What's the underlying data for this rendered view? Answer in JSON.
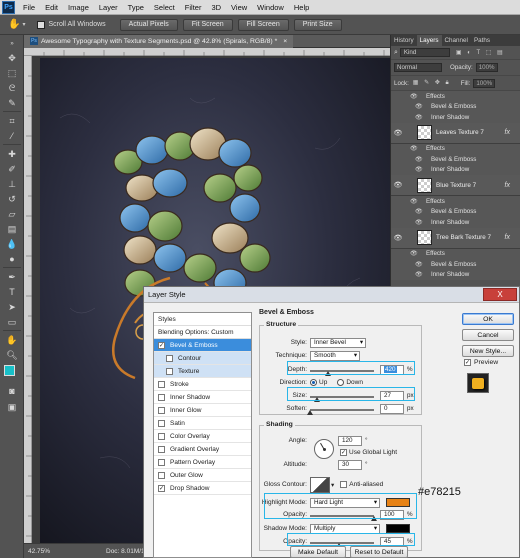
{
  "menubar": {
    "logo": "Ps",
    "items": [
      "File",
      "Edit",
      "Image",
      "Layer",
      "Type",
      "Select",
      "Filter",
      "3D",
      "View",
      "Window",
      "Help"
    ]
  },
  "options": {
    "scroll_all_windows": "Scroll All Windows",
    "buttons": [
      "Actual Pixels",
      "Fit Screen",
      "Fill Screen",
      "Print Size"
    ]
  },
  "document": {
    "tab_title": "Awesome Typography with Texture Segments.psd @ 42.8% (Spirals, RGB/8) *",
    "zoom": "42.75%",
    "doc_info": "Doc: 8.01M/125.8M"
  },
  "panels": {
    "tabs": [
      "History",
      "Layers",
      "Channel",
      "Paths"
    ],
    "active_tab": "Layers",
    "kind": "Kind",
    "blend_mode": "Normal",
    "opacity_label": "Opacity:",
    "opacity_value": "100%",
    "lock_label": "Lock:",
    "fill_label": "Fill:",
    "fill_value": "100%",
    "layers": [
      {
        "type": "sub",
        "label": "Effects",
        "effects": true
      },
      {
        "type": "sub",
        "label": "Bevel & Emboss"
      },
      {
        "type": "sub",
        "label": "Inner Shadow"
      },
      {
        "type": "layer",
        "label": "Leaves Texture 7",
        "fx": "fx"
      },
      {
        "type": "sub",
        "label": "Effects",
        "effects": true
      },
      {
        "type": "sub",
        "label": "Bevel & Emboss"
      },
      {
        "type": "sub",
        "label": "Inner Shadow"
      },
      {
        "type": "layer",
        "label": "Blue Texture 7",
        "fx": "fx"
      },
      {
        "type": "sub",
        "label": "Effects",
        "effects": true
      },
      {
        "type": "sub",
        "label": "Bevel & Emboss"
      },
      {
        "type": "sub",
        "label": "Inner Shadow"
      },
      {
        "type": "layer",
        "label": "Tree Bark Texture 7",
        "fx": "fx"
      },
      {
        "type": "sub",
        "label": "Effects",
        "effects": true
      },
      {
        "type": "sub",
        "label": "Bevel & Emboss"
      },
      {
        "type": "sub",
        "label": "Inner Shadow"
      }
    ]
  },
  "dialog": {
    "title": "Layer Style",
    "close": "X",
    "styles_header": "Styles",
    "blending_options": "Blending Options: Custom",
    "styles": [
      {
        "label": "Bevel & Emboss",
        "checked": true,
        "selected": true
      },
      {
        "label": "Contour",
        "checked": false,
        "indent": true
      },
      {
        "label": "Texture",
        "checked": false,
        "indent": true
      },
      {
        "label": "Stroke",
        "checked": false
      },
      {
        "label": "Inner Shadow",
        "checked": false
      },
      {
        "label": "Inner Glow",
        "checked": false
      },
      {
        "label": "Satin",
        "checked": false
      },
      {
        "label": "Color Overlay",
        "checked": false
      },
      {
        "label": "Gradient Overlay",
        "checked": false
      },
      {
        "label": "Pattern Overlay",
        "checked": false
      },
      {
        "label": "Outer Glow",
        "checked": false
      },
      {
        "label": "Drop Shadow",
        "checked": true
      }
    ],
    "section_title": "Bevel & Emboss",
    "structure": {
      "title": "Structure",
      "style_label": "Style:",
      "style_value": "Inner Bevel",
      "technique_label": "Technique:",
      "technique_value": "Smooth",
      "depth_label": "Depth:",
      "depth_value": "420",
      "depth_unit": "%",
      "depth_level": 0.28,
      "direction_label": "Direction:",
      "direction_up": "Up",
      "direction_down": "Down",
      "size_label": "Size:",
      "size_value": "27",
      "size_unit": "px",
      "size_level": 0.11,
      "soften_label": "Soften:",
      "soften_value": "0",
      "soften_unit": "px",
      "soften_level": 0.0
    },
    "shading": {
      "title": "Shading",
      "angle_label": "Angle:",
      "angle_value": "120",
      "angle_unit": "°",
      "global_light": "Use Global Light",
      "altitude_label": "Altitude:",
      "altitude_value": "30",
      "altitude_unit": "°",
      "gloss_label": "Gloss Contour:",
      "anti_aliased": "Anti-aliased",
      "highlight_label": "Highlight Mode:",
      "highlight_value": "Hard Light",
      "highlight_color": "#e78215",
      "hl_opacity_label": "Opacity:",
      "hl_opacity_value": "100",
      "hl_opacity_unit": "%",
      "hl_opacity_level": 1.0,
      "shadow_label": "Shadow Mode:",
      "shadow_value": "Multiply",
      "shadow_color": "#000000",
      "sh_opacity_label": "Opacity:",
      "sh_opacity_value": "45",
      "sh_opacity_unit": "%",
      "sh_opacity_level": 0.45
    },
    "make_default": "Make Default",
    "reset_default": "Reset to Default",
    "ok": "OK",
    "cancel": "Cancel",
    "new_style": "New Style...",
    "preview": "Preview"
  },
  "annotation": "#e78215",
  "colors": {
    "accent": "#29b6e8",
    "highlight_swatch": "#e78215",
    "fg_swatch": "#18c0c8"
  }
}
